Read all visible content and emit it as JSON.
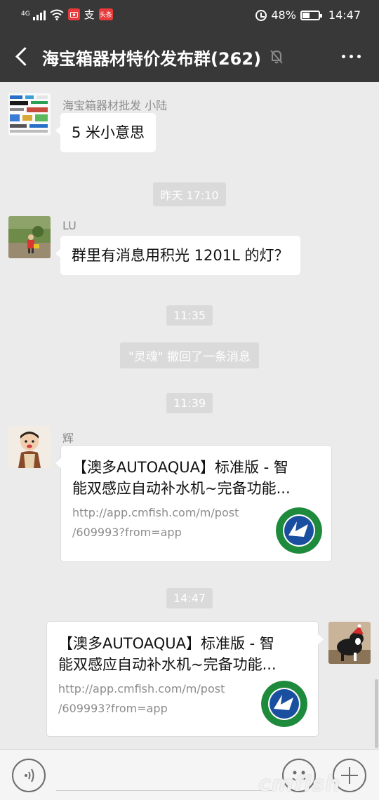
{
  "status_bar": {
    "network": "4G",
    "app_badge": "头条",
    "app_badge_color": "#e8393b",
    "alipay_glyph": "支",
    "battery": "48%",
    "battery_level": 0.48,
    "time": "14:47",
    "icons": [
      "signal-icon",
      "wifi-icon",
      "app-notification-icon",
      "alipay-icon",
      "toutiao-icon",
      "alarm-icon",
      "battery-icon"
    ]
  },
  "header": {
    "title": "海宝箱器材特价发布群(262)",
    "icons": [
      "back-arrow-icon",
      "mute-bell-icon",
      "more-dots-icon"
    ]
  },
  "messages": {
    "m1": {
      "sender": "海宝箱器材批发 小陆",
      "text": "5 米小意思"
    },
    "t1": "昨天 17:10",
    "m2": {
      "sender": "LU",
      "text": "群里有消息用积光 1201L 的灯？"
    },
    "t2": "11:35",
    "recall": "\"灵魂\" 撤回了一条消息",
    "t3": "11:39",
    "m3": {
      "sender": "辉",
      "title_line1": "【澳多AUTOAQUA】标准版 - 智",
      "title_line2": "能双感应自动补水机~完备功能...",
      "url_line1": "http://app.cmfish.com/m/post",
      "url_line2": "/609993?from=app"
    },
    "t4": "14:47",
    "m4": {
      "title_line1": "【澳多AUTOAQUA】标准版 - 智",
      "title_line2": "能双感应自动补水机~完备功能...",
      "url_line1": "http://app.cmfish.com/m/post",
      "url_line2": "/609993?from=app"
    }
  },
  "input_bar": {
    "icons": [
      "voice-icon",
      "emoji-icon",
      "plus-icon"
    ]
  },
  "watermark": "cmfish",
  "colors": {
    "header_bg": "#383838",
    "chat_bg": "#ebebeb",
    "logo_green": "#1e8a3c",
    "logo_blue": "#1a4fa0"
  }
}
